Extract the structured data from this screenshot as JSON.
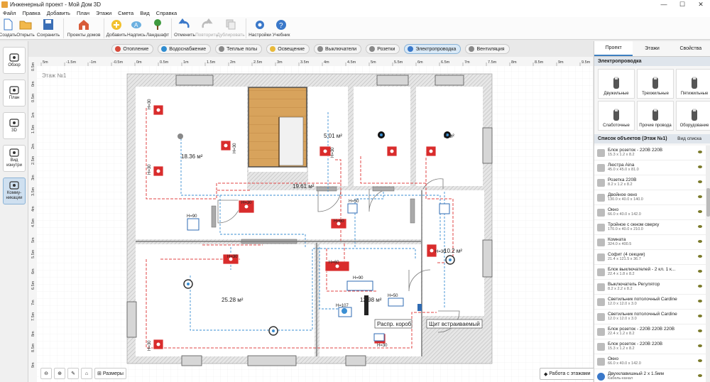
{
  "window": {
    "title": "Инженерный проект - Мой Дом 3D",
    "min": "—",
    "max": "☐",
    "close": "✕"
  },
  "menu": [
    "Файл",
    "Правка",
    "Добавить",
    "План",
    "Этажи",
    "Смета",
    "Вид",
    "Справка"
  ],
  "toolbar": [
    {
      "label": "Создать",
      "icon": "new-file-icon",
      "w": 22,
      "disabled": false
    },
    {
      "label": "Открыть",
      "icon": "open-folder-icon",
      "w": 28,
      "disabled": false
    },
    {
      "label": "Сохранить",
      "icon": "save-icon",
      "w": 36,
      "disabled": false
    },
    {
      "label": "Проекты домов",
      "icon": "house-projects-icon",
      "w": 50,
      "disabled": false
    },
    {
      "label": "Добавить",
      "icon": "add-icon",
      "w": 28,
      "disabled": false
    },
    {
      "label": "Надпись",
      "icon": "text-label-icon",
      "w": 28,
      "disabled": false
    },
    {
      "label": "Ландшафт",
      "icon": "landscape-icon",
      "w": 32,
      "disabled": false
    },
    {
      "label": "Отменить",
      "icon": "undo-icon",
      "w": 30,
      "disabled": false
    },
    {
      "label": "Повторить",
      "icon": "redo-icon",
      "w": 32,
      "disabled": true
    },
    {
      "label": "Дублировать",
      "icon": "duplicate-icon",
      "w": 36,
      "disabled": true
    },
    {
      "label": "Настройки",
      "icon": "settings-icon",
      "w": 32,
      "disabled": false
    },
    {
      "label": "Учебник",
      "icon": "tutorial-icon",
      "w": 28,
      "disabled": false
    }
  ],
  "categories": [
    {
      "label": "Отопление",
      "color": "#d74a3a",
      "active": false
    },
    {
      "label": "Водоснабжение",
      "color": "#2f8cd0",
      "active": false
    },
    {
      "label": "Теплые полы",
      "color": "#888",
      "active": false
    },
    {
      "label": "Освещение",
      "color": "#e8b93a",
      "active": false
    },
    {
      "label": "Выключатели",
      "color": "#888",
      "active": false
    },
    {
      "label": "Розетки",
      "color": "#888",
      "active": false
    },
    {
      "label": "Электропроводка",
      "color": "#3a78c9",
      "active": true
    },
    {
      "label": "Вентиляция",
      "color": "#888",
      "active": false
    }
  ],
  "left_nav": [
    {
      "label": "Обзор",
      "icon": "eye-icon",
      "active": false
    },
    {
      "label": "План",
      "icon": "plan-icon",
      "active": false
    },
    {
      "label": "3D",
      "icon": "cube-3d-icon",
      "active": false
    },
    {
      "label": "Вид изнутри",
      "icon": "inside-view-icon",
      "active": false
    },
    {
      "label": "Комму- никации",
      "icon": "communications-icon",
      "active": true
    }
  ],
  "floor_label": "Этаж №1",
  "ruler_top": [
    "5m",
    "-1.5m",
    "-1m",
    "-0.5m",
    "0m",
    "0.5m",
    "1m",
    "1.5m",
    "2m",
    "2.5m",
    "3m",
    "3.5m",
    "4m",
    "4.5m",
    "5m",
    "5.5m",
    "6m",
    "6.5m",
    "7m",
    "7.5m",
    "8m",
    "8.5m",
    "9m",
    "9.5m"
  ],
  "ruler_left": [
    "0.5m",
    "0m",
    "0.5m",
    "1m",
    "1.5m",
    "2m",
    "2.5m",
    "3m",
    "3.5m",
    "4m",
    "4.5m",
    "5m",
    "5.5m",
    "6m",
    "6.5m",
    "7m",
    "7.5m",
    "8m",
    "8.5m",
    "9m"
  ],
  "rooms": {
    "r1": "18.36 м²",
    "r2": "5.01 м²",
    "r3": "19.61 м²",
    "r4": "8 м²",
    "r5": "10.2 м²",
    "r6": "25.28 м²",
    "r7": "12.98 м²"
  },
  "heights": {
    "h30": "H=30",
    "h90": "H=90",
    "h60": "H=60",
    "h107": "H=107",
    "h50": "H=50"
  },
  "labels": {
    "distro_box": "Распр. короб",
    "panel": "Щит встраиваемый"
  },
  "right_panel": {
    "tabs": [
      "Проект",
      "Этажи",
      "Свойства"
    ],
    "section": "Электропроводка",
    "wire_types": [
      {
        "label": "Двужильные",
        "icon": "two-core-wire-icon"
      },
      {
        "label": "Трехжильные",
        "icon": "three-core-wire-icon"
      },
      {
        "label": "Пятижильные",
        "icon": "five-core-wire-icon"
      },
      {
        "label": "Слаботочные",
        "icon": "low-current-wire-icon"
      },
      {
        "label": "Прочие провода",
        "icon": "other-wires-icon"
      },
      {
        "label": "Оборудование",
        "icon": "equipment-icon"
      }
    ],
    "list_title": "Список объектов (Этаж №1)",
    "view_mode": "Вид списка",
    "objects": [
      {
        "name": "Блок розеток - 220В 220В",
        "dims": "15.3 x 1.2 x 8.2",
        "icon": "socket-block-icon"
      },
      {
        "name": "Люстра Aina",
        "dims": "45.0 x 45.0 x 81.0",
        "icon": "chandelier-icon"
      },
      {
        "name": "Розетка 220В",
        "dims": "8.2 x 1.2 x 8.2",
        "icon": "socket-icon"
      },
      {
        "name": "Двойное окно",
        "dims": "130.0 x 40.0 x 140.0",
        "icon": "window-icon"
      },
      {
        "name": "Окно",
        "dims": "66.0 x 40.0 x 142.0",
        "icon": "window-icon"
      },
      {
        "name": "Тройное с окном сверху",
        "dims": "170.0 x 40.0 x 210.0",
        "icon": "triple-window-icon"
      },
      {
        "name": "Комната",
        "dims": "324.0 x 400.5",
        "icon": "room-icon"
      },
      {
        "name": "Софит (4 секции)",
        "dims": "21.4 x 121.5 x 36.7",
        "icon": "soffit-icon"
      },
      {
        "name": "Блок выключателей - 2 кл. 1 к...",
        "dims": "22.4 x 1.8 x 8.2",
        "icon": "switch-block-icon"
      },
      {
        "name": "Выключатель Регулятор",
        "dims": "8.2 x 2.2 x 8.2",
        "icon": "dimmer-icon"
      },
      {
        "name": "Светильник потолочный Cardine",
        "dims": "12.0 x 12.0 x 3.0",
        "icon": "ceiling-light-icon"
      },
      {
        "name": "Светильник потолочный Cardine",
        "dims": "12.0 x 12.0 x 3.0",
        "icon": "ceiling-light-icon"
      },
      {
        "name": "Блок розеток - 220В 220В 220В",
        "dims": "22.4 x 1.2 x 8.2",
        "icon": "socket-block-icon"
      },
      {
        "name": "Блок розеток - 220В 220В",
        "dims": "15.3 x 1.2 x 8.2",
        "icon": "socket-block-icon"
      },
      {
        "name": "Окно",
        "dims": "66.0 x 40.0 x 142.0",
        "icon": "window-icon"
      },
      {
        "name": "Двухклавишный 2 x 1.5мм",
        "dims": "Кабель-канал",
        "icon": "wire-icon"
      }
    ]
  },
  "bottom": {
    "dims_label": "Размеры",
    "floor_btn": "Работа с этажами"
  }
}
